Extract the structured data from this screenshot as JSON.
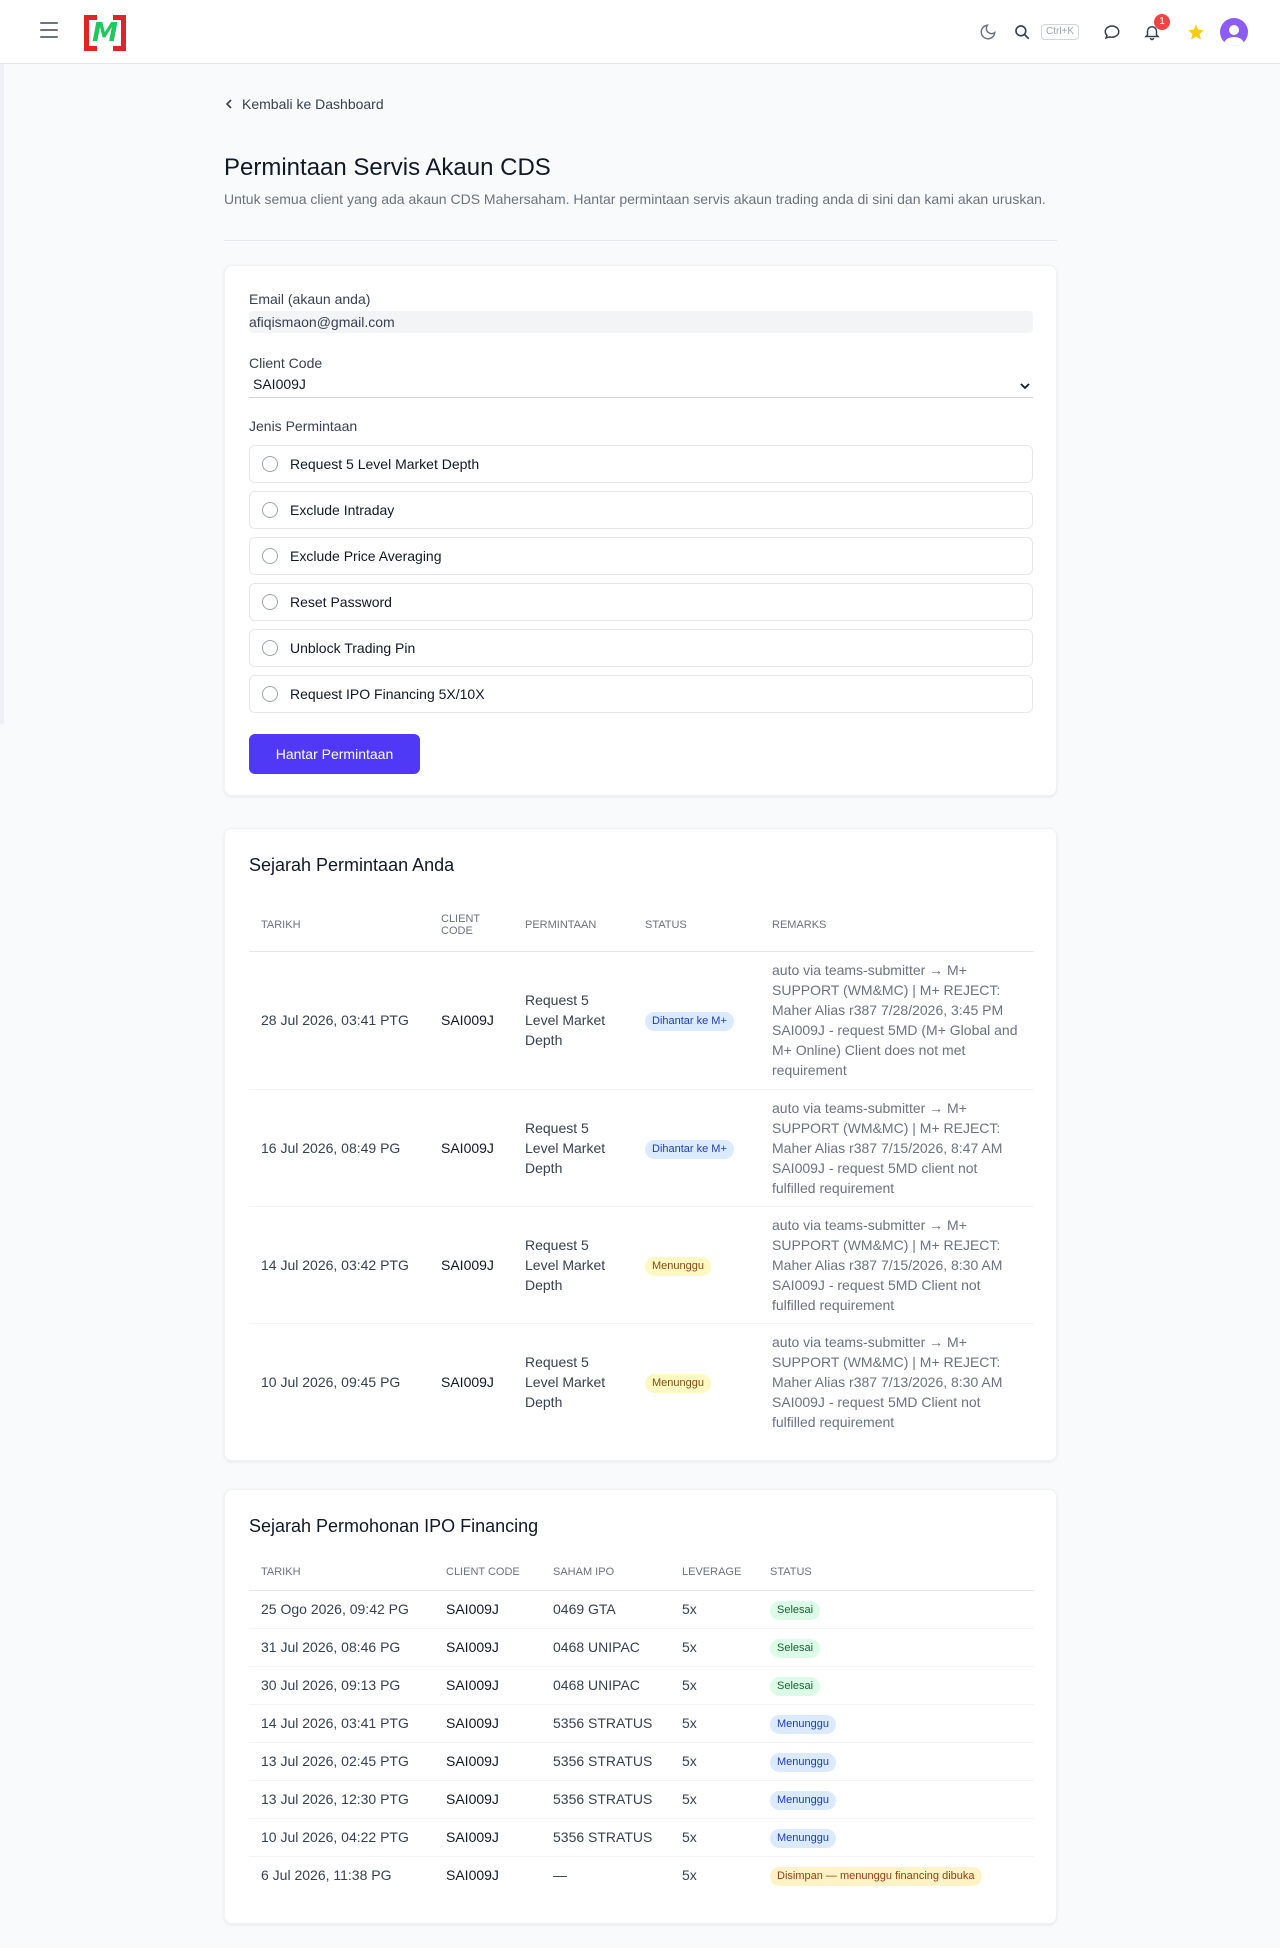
{
  "header": {
    "logo_text": "M",
    "shortcut": "Ctrl+K",
    "notification_count": "1"
  },
  "back_link": "Kembali ke Dashboard",
  "page": {
    "title": "Permintaan Servis Akaun CDS",
    "description": "Untuk semua client yang ada akaun CDS Mahersaham. Hantar permintaan servis akaun trading anda di sini dan kami akan uruskan."
  },
  "form": {
    "email_label": "Email (akaun anda)",
    "email_value": "afiqismaon@gmail.com",
    "client_code_label": "Client Code",
    "client_code_value": "SAI009J",
    "request_type_label": "Jenis Permintaan",
    "options": [
      "Request 5 Level Market Depth",
      "Exclude Intraday",
      "Exclude Price Averaging",
      "Reset Password",
      "Unblock Trading Pin",
      "Request IPO Financing 5X/10X"
    ],
    "submit_label": "Hantar Permintaan"
  },
  "history": {
    "title": "Sejarah Permintaan Anda",
    "columns": [
      "Tarikh",
      "Client Code",
      "Permintaan",
      "Status",
      "Remarks"
    ],
    "rows": [
      {
        "date": "28 Jul 2026, 03:41 PTG",
        "code": "SAI009J",
        "request": "Request 5 Level Market Depth",
        "status": "Dihantar ke M+",
        "remarks": "auto via teams-submitter → M+ SUPPORT (WM&MC) | M+ REJECT: Maher Alias r387 7/28/2026, 3:45 PM SAI009J - request 5MD (M+ Global and M+ Online) Client does not met requirement"
      },
      {
        "date": "16 Jul 2026, 08:49 PG",
        "code": "SAI009J",
        "request": "Request 5 Level Market Depth",
        "status": "Dihantar ke M+",
        "remarks": "auto via teams-submitter → M+ SUPPORT (WM&MC) | M+ REJECT: Maher Alias r387 7/15/2026, 8:47 AM SAI009J - request 5MD client not fulfilled requirement"
      },
      {
        "date": "14 Jul 2026, 03:42 PTG",
        "code": "SAI009J",
        "request": "Request 5 Level Market Depth",
        "status": "Menunggu",
        "remarks": "auto via teams-submitter → M+ SUPPORT (WM&MC) | M+ REJECT: Maher Alias r387 7/15/2026, 8:30 AM SAI009J - request 5MD Client not fulfilled requirement"
      },
      {
        "date": "10 Jul 2026, 09:45 PG",
        "code": "SAI009J",
        "request": "Request 5 Level Market Depth",
        "status": "Menunggu",
        "remarks": "auto via teams-submitter → M+ SUPPORT (WM&MC) | M+ REJECT: Maher Alias r387 7/13/2026, 8:30 AM SAI009J - request 5MD Client not fulfilled requirement"
      }
    ]
  },
  "ipo": {
    "title": "Sejarah Permohonan IPO Financing",
    "columns": [
      "Tarikh",
      "Client Code",
      "Saham IPO",
      "Leverage",
      "Status"
    ],
    "rows": [
      {
        "date": "25 Ogo 2026, 09:42 PG",
        "code": "SAI009J",
        "stock": "0469 GTA",
        "leverage": "5x",
        "status": "Selesai"
      },
      {
        "date": "31 Jul 2026, 08:46 PG",
        "code": "SAI009J",
        "stock": "0468 UNIPAC",
        "leverage": "5x",
        "status": "Selesai"
      },
      {
        "date": "30 Jul 2026, 09:13 PG",
        "code": "SAI009J",
        "stock": "0468 UNIPAC",
        "leverage": "5x",
        "status": "Selesai"
      },
      {
        "date": "14 Jul 2026, 03:41 PTG",
        "code": "SAI009J",
        "stock": "5356 STRATUS",
        "leverage": "5x",
        "status": "Menunggu"
      },
      {
        "date": "13 Jul 2026, 02:45 PTG",
        "code": "SAI009J",
        "stock": "5356 STRATUS",
        "leverage": "5x",
        "status": "Menunggu"
      },
      {
        "date": "13 Jul 2026, 12:30 PTG",
        "code": "SAI009J",
        "stock": "5356 STRATUS",
        "leverage": "5x",
        "status": "Menunggu"
      },
      {
        "date": "10 Jul 2026, 04:22 PTG",
        "code": "SAI009J",
        "stock": "5356 STRATUS",
        "leverage": "5x",
        "status": "Menunggu"
      },
      {
        "date": "6 Jul 2026, 11:38 PG",
        "code": "SAI009J",
        "stock": "—",
        "leverage": "5x",
        "status": "Disimpan — menunggu financing dibuka"
      }
    ]
  },
  "colors": {
    "accent": "#4f39f6",
    "logo_red": "#dc2626",
    "logo_green": "#22c55e",
    "star": "#facc15",
    "avatar": "#8b5cf6"
  },
  "icons": [
    "menu-icon",
    "moon-icon",
    "search-icon",
    "chat-icon",
    "bell-icon",
    "star-icon",
    "user-icon",
    "chevron-left-icon",
    "chevron-down-icon"
  ]
}
